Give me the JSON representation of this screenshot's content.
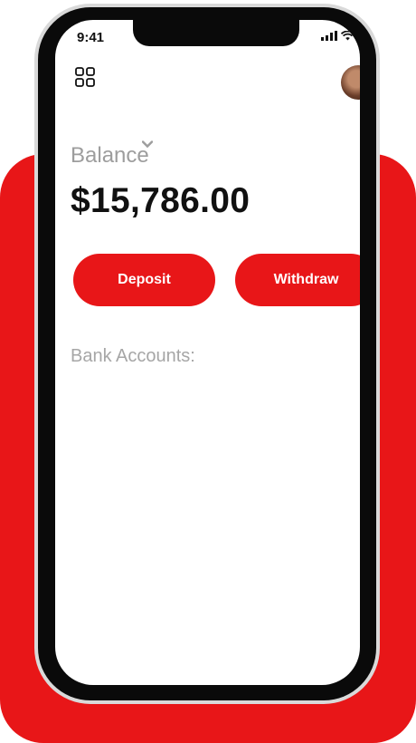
{
  "status_bar": {
    "time": "9:41"
  },
  "balance": {
    "label": "Balance",
    "amount": "$15,786.00"
  },
  "actions": {
    "deposit_label": "Deposit",
    "withdraw_label": "Withdraw"
  },
  "accounts": {
    "label": "Bank Accounts:"
  },
  "colors": {
    "accent": "#e81618",
    "text": "#111111",
    "muted": "#9d9d9d"
  },
  "icons": {
    "menu": "grid-menu-icon",
    "chevron": "chevron-down-icon",
    "signal": "signal-icon",
    "wifi": "wifi-icon",
    "battery": "battery-icon"
  }
}
